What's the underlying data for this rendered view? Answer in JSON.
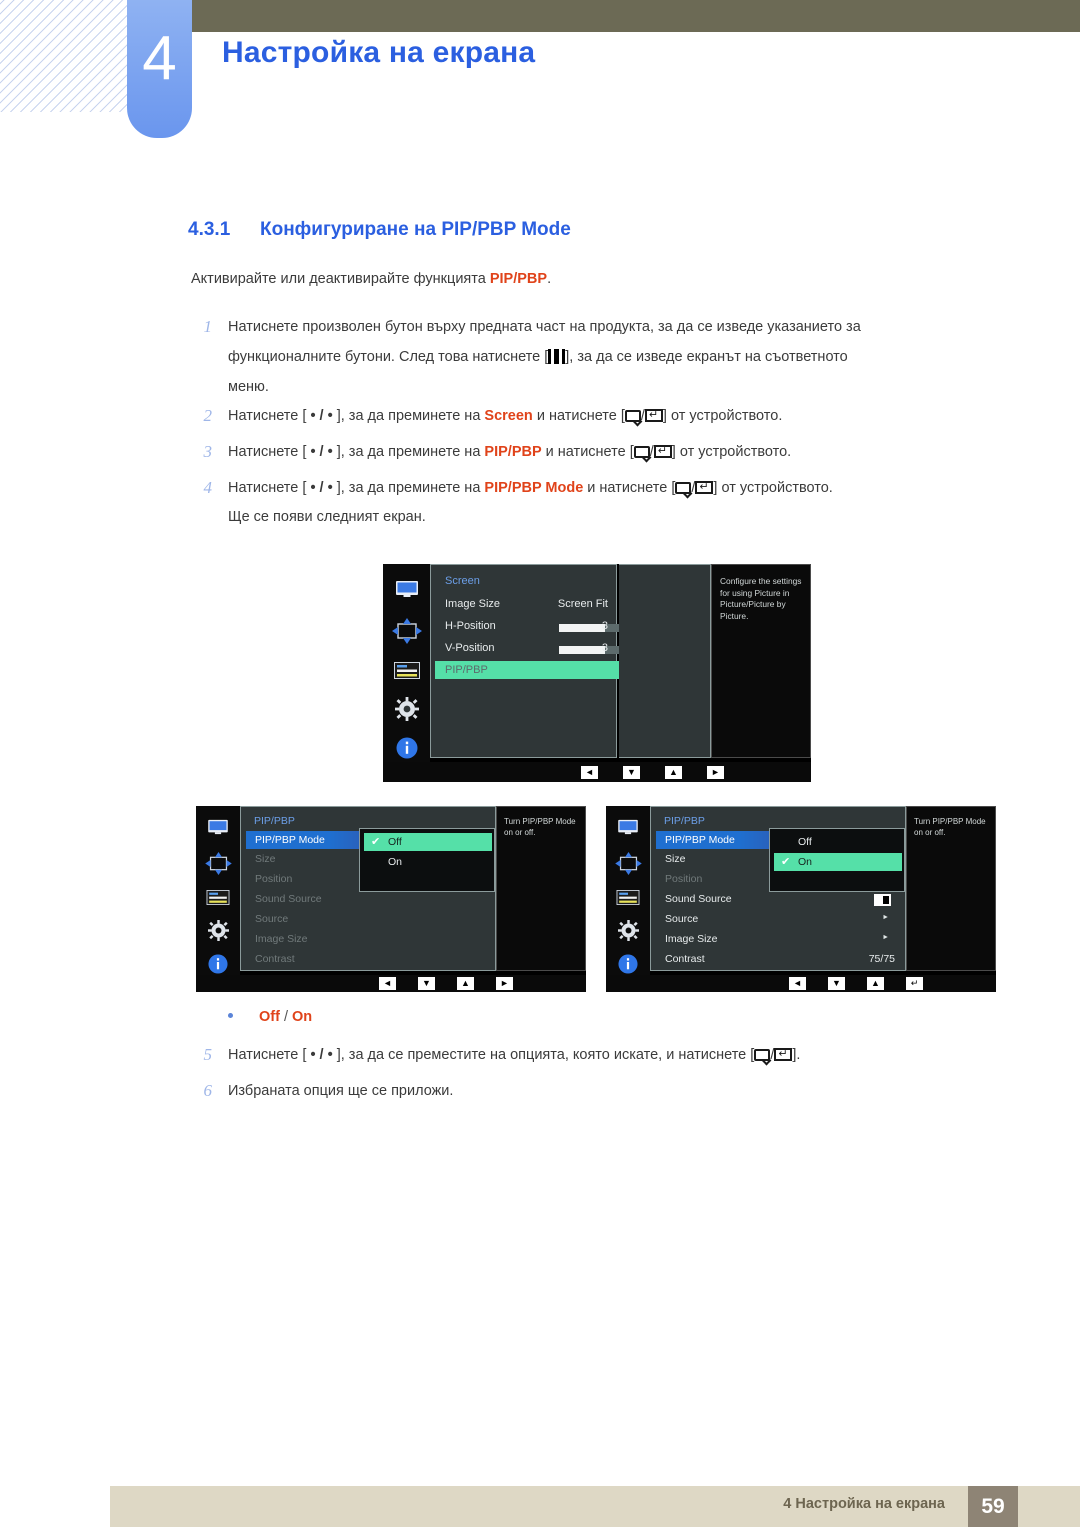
{
  "header": {
    "chapter_number": "4",
    "chapter_title": "Настройка на екрана"
  },
  "section": {
    "number": "4.3.1",
    "title": "Конфигуриране на PIP/PBP Mode",
    "lead_before": "Активирайте или деактивирайте функцията ",
    "lead_highlight": "PIP/PBP",
    "lead_after": "."
  },
  "steps": {
    "s1": {
      "index": "1",
      "line1": "Натиснете произволен бутон върху предната част на продукта, за да се изведе указанието за",
      "line2a": "функционалните бутони. След това натиснете [",
      "line2b": "], за да се изведе екранът на съответното",
      "line3": "меню."
    },
    "s2": {
      "index": "2",
      "a": "Натиснете [ ",
      "dots": "• / •",
      "b": " ], за да преминете на ",
      "target": "Screen",
      "c": " и натиснете [",
      "d": "] от устройството."
    },
    "s3": {
      "index": "3",
      "target": "PIP/PBP"
    },
    "s4": {
      "index": "4",
      "target": "PIP/PBP Mode",
      "after": "Ще се появи следният екран."
    },
    "s5": {
      "index": "5",
      "a": "Натиснете [ ",
      "dots": "• / •",
      "b": " ], за да се преместите на опцията, която искате, и натиснете [",
      "d": "]."
    },
    "s6": {
      "index": "6",
      "text": "Избраната опция ще се приложи."
    }
  },
  "bullet": {
    "off": "Off",
    "separator": "/",
    "on": "On"
  },
  "osd_screen": {
    "menu_title": "Screen",
    "rows": [
      {
        "label": "Image Size",
        "value": "Screen Fit"
      },
      {
        "label": "H-Position",
        "value": "3",
        "slider": 45
      },
      {
        "label": "V-Position",
        "value": "3",
        "slider": 45
      },
      {
        "label": "PIP/PBP",
        "value": "",
        "arrow": "►",
        "highlight": "green"
      }
    ],
    "description": "Configure the settings for using Picture in Picture/Picture by Picture.",
    "nav": [
      "◄",
      "▼",
      "▲",
      "►"
    ]
  },
  "osd_off": {
    "menu_title": "PIP/PBP",
    "rows": [
      {
        "label": "PIP/PBP Mode",
        "state": "blue"
      },
      {
        "label": "Size",
        "state": "dim"
      },
      {
        "label": "Position",
        "state": "dim"
      },
      {
        "label": "Sound Source",
        "state": "dim"
      },
      {
        "label": "Source",
        "state": "dim"
      },
      {
        "label": "Image Size",
        "state": "dim"
      },
      {
        "label": "Contrast",
        "state": "dim"
      }
    ],
    "popup": [
      {
        "label": "Off",
        "selected": true
      },
      {
        "label": "On",
        "selected": false
      }
    ],
    "description": "Turn PIP/PBP Mode on or off.",
    "nav": [
      "◄",
      "▼",
      "▲",
      "►"
    ]
  },
  "osd_on": {
    "menu_title": "PIP/PBP",
    "rows": [
      {
        "label": "PIP/PBP Mode",
        "state": "blue",
        "value": ""
      },
      {
        "label": "Size",
        "state": "normal",
        "value": ""
      },
      {
        "label": "Position",
        "state": "dim",
        "value": ""
      },
      {
        "label": "Sound Source",
        "state": "normal",
        "value": "toggle"
      },
      {
        "label": "Source",
        "state": "normal",
        "value": "►"
      },
      {
        "label": "Image Size",
        "state": "normal",
        "value": "►"
      },
      {
        "label": "Contrast",
        "state": "normal",
        "value": "75/75"
      }
    ],
    "popup": [
      {
        "label": "Off",
        "selected": false
      },
      {
        "label": "On",
        "selected": true
      }
    ],
    "description": "Turn PIP/PBP Mode on or off.",
    "nav": [
      "◄",
      "▼",
      "▲",
      "↵"
    ]
  },
  "rail_icons": [
    "monitor-icon",
    "position-arrows-icon",
    "osd-lines-icon",
    "gear-icon",
    "info-icon"
  ],
  "footer": {
    "text": "4 Настройка на екрана",
    "page": "59"
  },
  "colors": {
    "accent_blue": "#2b5fe0",
    "orange": "#e0431a",
    "header_bar": "#6c6a55",
    "footer_bar": "#ded8c5",
    "page_box": "#8e8475",
    "osd_green": "#55e0a8",
    "osd_blue": "#1f6fd0"
  }
}
